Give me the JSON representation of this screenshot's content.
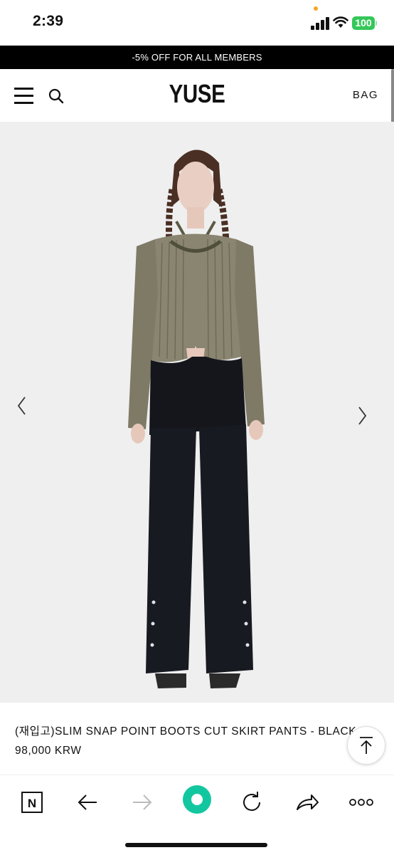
{
  "status_bar": {
    "time": "2:39",
    "battery": "100"
  },
  "promo": {
    "text": "-5% OFF FOR ALL MEMBERS"
  },
  "header": {
    "logo": "YUSE",
    "bag_label": "BAG"
  },
  "product": {
    "name": "(재입고)SLIM SNAP POINT BOOTS CUT SKIRT PANTS - BLACK",
    "price": "98,000 KRW"
  },
  "icons": {
    "menu": "hamburger-icon",
    "search": "search-icon",
    "prev": "chevron-left-icon",
    "next": "chevron-right-icon",
    "scroll_top": "arrow-up-icon",
    "toolbar": [
      "naver-icon",
      "back-arrow-icon",
      "forward-arrow-icon",
      "green-home-icon",
      "reload-icon",
      "share-icon",
      "more-icon"
    ]
  },
  "colors": {
    "accent_green": "#12c7a0",
    "promo_bg": "#000000",
    "battery_green": "#34c759"
  }
}
